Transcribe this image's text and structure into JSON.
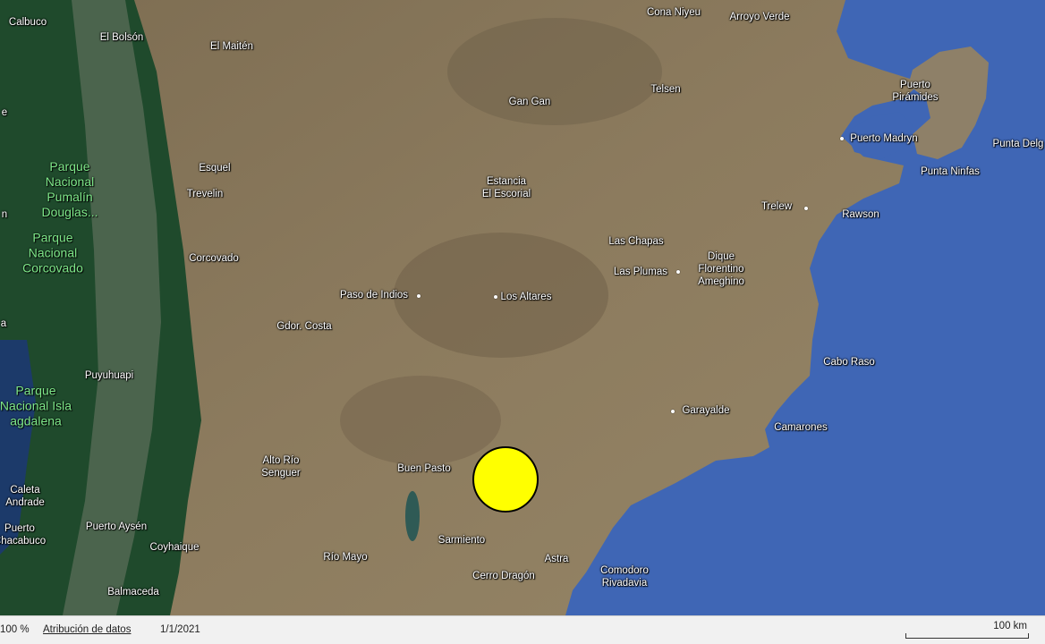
{
  "map": {
    "colors": {
      "ocean": "#3f66b5",
      "land": "#8a7a5f",
      "forest": "#1f4a2c",
      "marker": "#ffff00"
    },
    "places": [
      {
        "id": "calbuco",
        "label": "Calbuco"
      },
      {
        "id": "el-bolson",
        "label": "El Bolsón"
      },
      {
        "id": "el-maiten",
        "label": "El Maitén"
      },
      {
        "id": "cona-niyeu",
        "label": "Cona Niyeu"
      },
      {
        "id": "arroyo-verde",
        "label": "Arroyo Verde"
      },
      {
        "id": "puerto-piramides",
        "label": "Puerto\nPirámides"
      },
      {
        "id": "gan-gan",
        "label": "Gan Gan"
      },
      {
        "id": "telsen",
        "label": "Telsen"
      },
      {
        "id": "puerto-madryn",
        "label": "Puerto Madryn"
      },
      {
        "id": "punta-delgada",
        "label": "Punta Delg"
      },
      {
        "id": "esquel",
        "label": "Esquel"
      },
      {
        "id": "punta-ninfas",
        "label": "Punta Ninfas"
      },
      {
        "id": "estancia-el-escorial",
        "label": "Estancia\nEl Escorial"
      },
      {
        "id": "trevelin",
        "label": "Trevelin"
      },
      {
        "id": "trelew",
        "label": "Trelew"
      },
      {
        "id": "rawson",
        "label": "Rawson"
      },
      {
        "id": "las-chapas",
        "label": "Las Chapas"
      },
      {
        "id": "corcovado",
        "label": "Corcovado"
      },
      {
        "id": "las-plumas",
        "label": "Las Plumas"
      },
      {
        "id": "dique-florentino-ameghino",
        "label": "Dique\nFlorentino\nAmeghino"
      },
      {
        "id": "paso-de-indios",
        "label": "Paso de Indios"
      },
      {
        "id": "los-altares",
        "label": "Los Altares"
      },
      {
        "id": "gdor-costa",
        "label": "Gdor. Costa"
      },
      {
        "id": "cabo-raso",
        "label": "Cabo Raso"
      },
      {
        "id": "puyuhuapi",
        "label": "Puyuhuapi"
      },
      {
        "id": "garayalde",
        "label": "Garayalde"
      },
      {
        "id": "camarones",
        "label": "Camarones"
      },
      {
        "id": "alto-rio-senguer",
        "label": "Alto Río\nSenguer"
      },
      {
        "id": "buen-pasto",
        "label": "Buen Pasto"
      },
      {
        "id": "caleta-andrade",
        "label": "Caleta\nAndrade"
      },
      {
        "id": "puerto-aysen",
        "label": "Puerto Aysén"
      },
      {
        "id": "puerto-chacabuco",
        "label": "Puerto\nChacabuco"
      },
      {
        "id": "coyhaique",
        "label": "Coyhaique"
      },
      {
        "id": "sarmiento",
        "label": "Sarmiento"
      },
      {
        "id": "rio-mayo",
        "label": "Río Mayo"
      },
      {
        "id": "astra",
        "label": "Astra"
      },
      {
        "id": "comodoro-rivadavia",
        "label": "Comodoro\nRivadavia"
      },
      {
        "id": "cerro-dragon",
        "label": "Cerro Dragón"
      },
      {
        "id": "balmaceda",
        "label": "Balmaceda"
      }
    ],
    "parks": [
      {
        "id": "parque-nacional-pumalin-douglas",
        "label": "Parque\nNacional\nPumalín\nDouglas..."
      },
      {
        "id": "parque-nacional-corcovado",
        "label": "Parque\nNacional\nCorcovado"
      },
      {
        "id": "parque-nacional-isla-magdalena",
        "label": "Parque\nNacional Isla\nagdalena"
      }
    ],
    "edge_labels": [
      {
        "id": "edge-e",
        "label": "e"
      },
      {
        "id": "edge-n",
        "label": "n"
      },
      {
        "id": "edge-a",
        "label": "a"
      }
    ]
  },
  "status_bar": {
    "zoom": "100 %",
    "attribution": "Atribución de datos",
    "date": "1/1/2021",
    "scale_label": "100 km"
  }
}
